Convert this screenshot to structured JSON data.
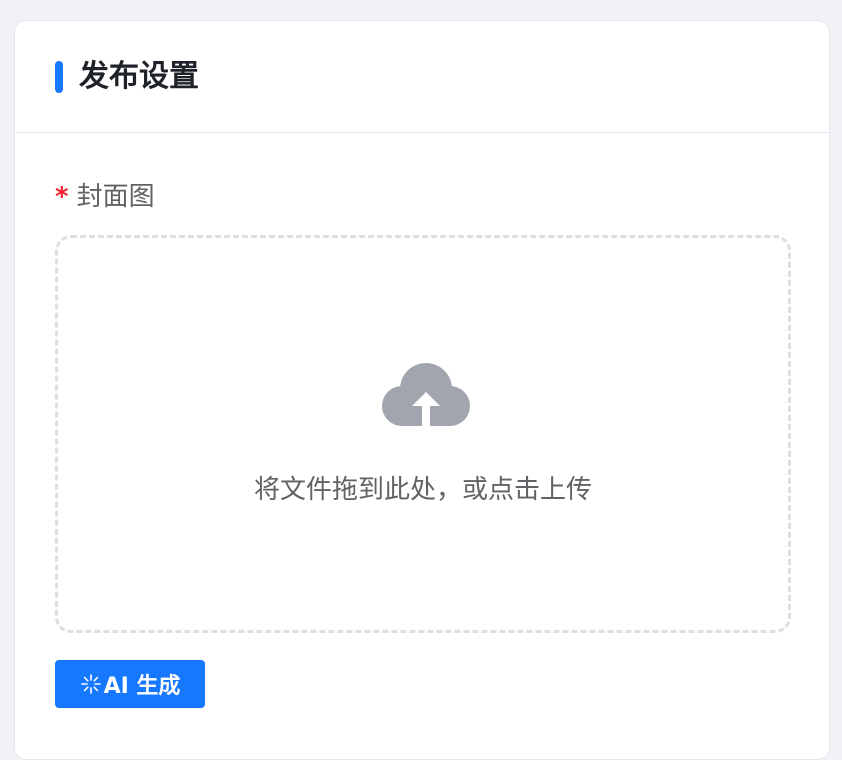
{
  "header": {
    "title": "发布设置"
  },
  "cover": {
    "required_mark": "*",
    "label": "封面图"
  },
  "upload": {
    "icon": "cloud-upload-icon",
    "hint": "将文件拖到此处，或点击上传"
  },
  "ai_button": {
    "icon": "sparkle-icon",
    "label": "AI 生成"
  },
  "colors": {
    "accent": "#1677ff",
    "required": "#f5222d",
    "icon_gray": "#a1a5ae"
  }
}
